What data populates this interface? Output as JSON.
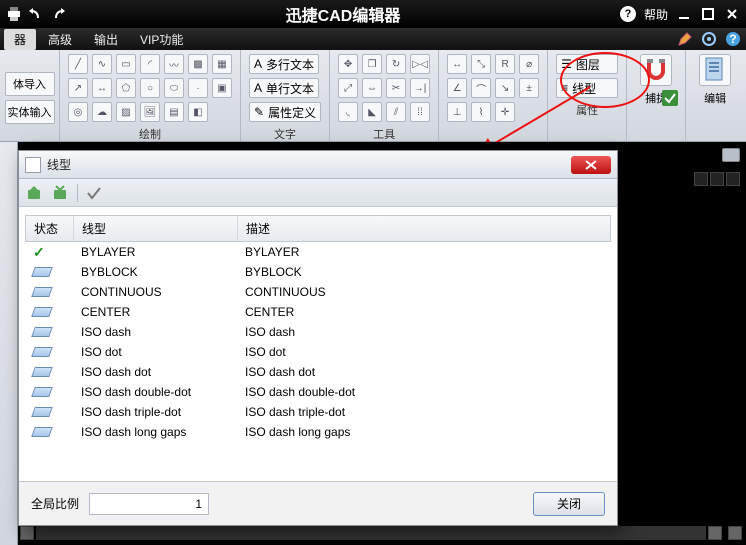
{
  "app": {
    "title": "迅捷CAD编辑器",
    "help_label": "帮助"
  },
  "menubar": {
    "items": [
      {
        "label": "器"
      },
      {
        "label": "高级"
      },
      {
        "label": "输出"
      },
      {
        "label": "VIP功能"
      }
    ]
  },
  "ribbon": {
    "panel_left": {
      "btn1": "体导入",
      "btn2": "实体输入"
    },
    "groups": {
      "draw": {
        "label": "绘制"
      },
      "text": {
        "label": "文字",
        "items": [
          "多行文本",
          "单行文本",
          "属性定义"
        ]
      },
      "tools": {
        "label": "工具"
      },
      "attrs": {
        "label": "属性",
        "items": [
          "图层",
          "线型"
        ]
      },
      "snap": {
        "label": "捕捉"
      },
      "edit": {
        "label": "编辑"
      }
    }
  },
  "dialog": {
    "title": "线型",
    "columns": {
      "status": "状态",
      "name": "线型",
      "desc": "描述"
    },
    "rows": [
      {
        "selected": true,
        "name": "BYLAYER",
        "desc": "BYLAYER"
      },
      {
        "selected": false,
        "name": "BYBLOCK",
        "desc": "BYBLOCK"
      },
      {
        "selected": false,
        "name": "CONTINUOUS",
        "desc": "CONTINUOUS"
      },
      {
        "selected": false,
        "name": "CENTER",
        "desc": "CENTER"
      },
      {
        "selected": false,
        "name": "ISO dash",
        "desc": "ISO dash"
      },
      {
        "selected": false,
        "name": "ISO dot",
        "desc": "ISO dot"
      },
      {
        "selected": false,
        "name": "ISO dash dot",
        "desc": "ISO dash dot"
      },
      {
        "selected": false,
        "name": "ISO dash double-dot",
        "desc": "ISO dash double-dot"
      },
      {
        "selected": false,
        "name": "ISO dash triple-dot",
        "desc": "ISO dash triple-dot"
      },
      {
        "selected": false,
        "name": "ISO dash long gaps",
        "desc": "ISO dash long gaps"
      }
    ],
    "global_scale_label": "全局比例",
    "global_scale_value": "1",
    "close_label": "关闭"
  }
}
